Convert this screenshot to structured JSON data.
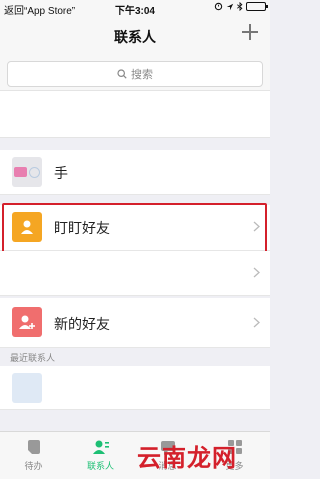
{
  "status_bar": {
    "back_label": "返回“App Store”",
    "time": "下午3:04"
  },
  "nav": {
    "title": "联系人"
  },
  "search": {
    "placeholder": "搜索"
  },
  "rows": {
    "hand": {
      "label": "手"
    },
    "dingding_friends": {
      "label": "盯盯好友"
    },
    "new_friends": {
      "label": "新的好友"
    }
  },
  "sections": {
    "recent": "最近联系人"
  },
  "tabs": [
    {
      "label": "待办"
    },
    {
      "label": "联系人"
    },
    {
      "label": "消息"
    },
    {
      "label": "更多"
    }
  ],
  "watermark": "云南龙网",
  "colors": {
    "accent": "#1dbf74",
    "highlight_border": "#d4202b",
    "dingding_icon_bg": "#f5a623",
    "new_friend_icon_bg": "#f06e6e"
  }
}
